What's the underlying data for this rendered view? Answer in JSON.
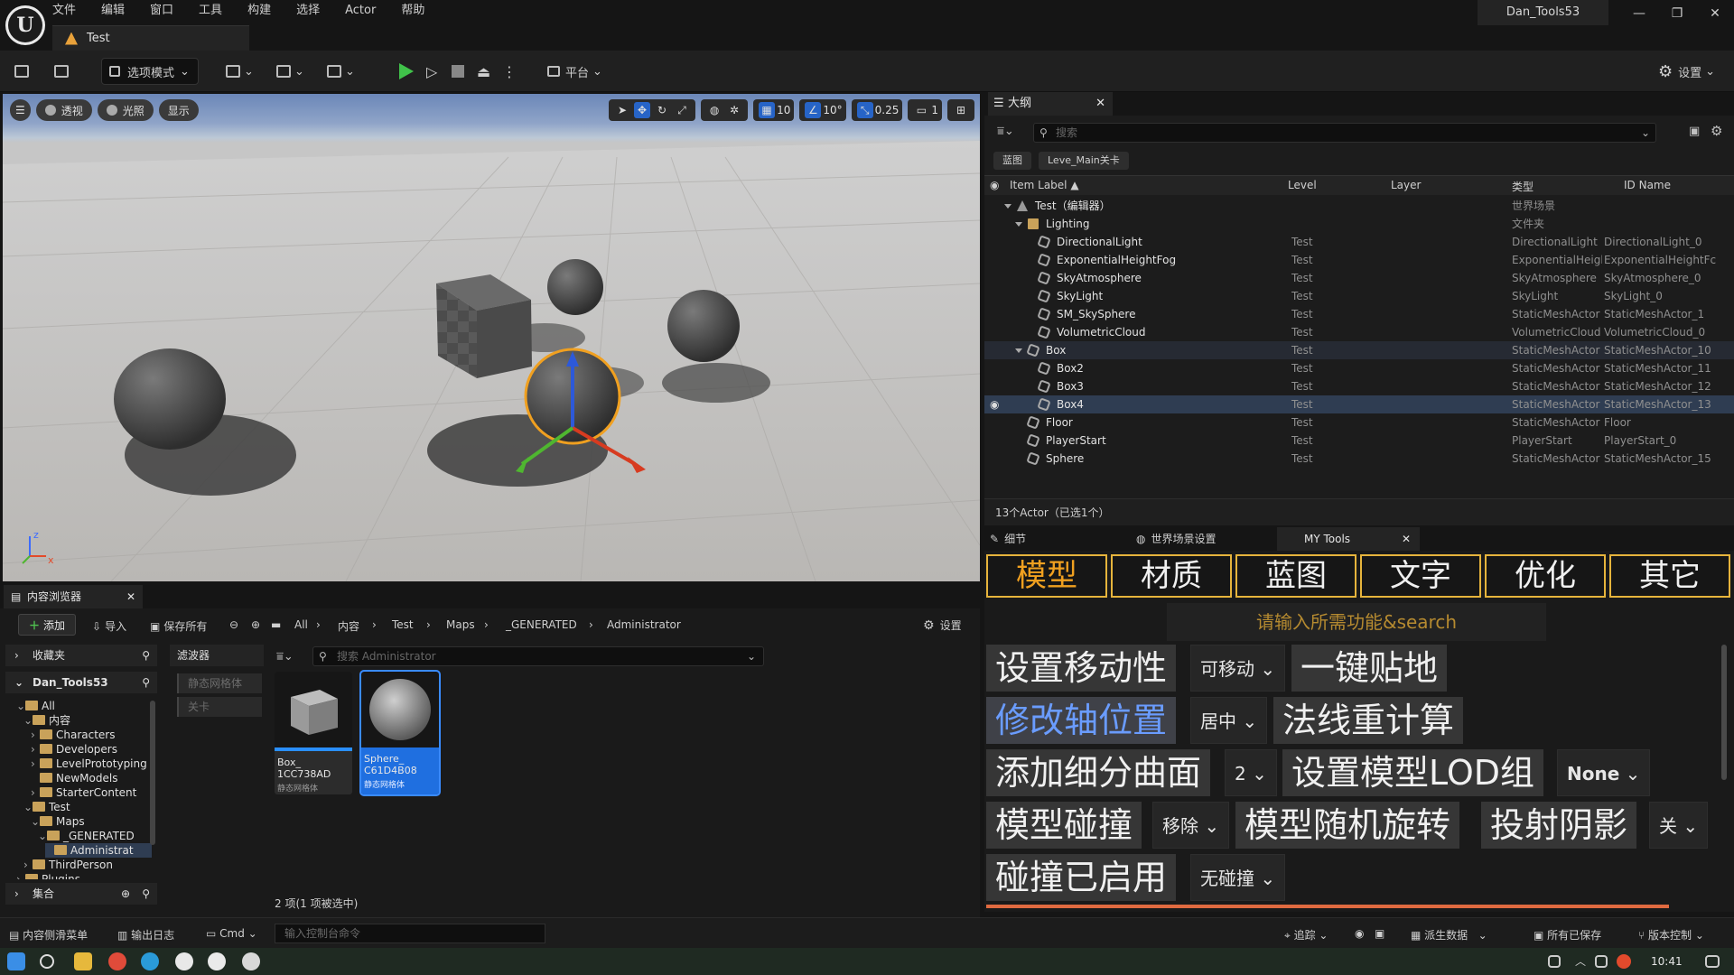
{
  "menu": [
    "文件",
    "编辑",
    "窗口",
    "工具",
    "构建",
    "选择",
    "Actor",
    "帮助"
  ],
  "level_tab": "Test",
  "project_name": "Dan_Tools53",
  "window_controls": {
    "minimize": "—",
    "restore": "❐",
    "close": "✕"
  },
  "toolbar": {
    "mode_label": "选项模式",
    "platform_label": "平台",
    "settings_label": "设置"
  },
  "viewport": {
    "perspective_label": "透视",
    "lighting_label": "光照",
    "show_label": "显示",
    "grid_snap": "10",
    "rotation_snap": "10°",
    "scale_snap": "0.25",
    "camera_speed": "1"
  },
  "outliner": {
    "tab_label": "大纲",
    "search_placeholder": "搜索",
    "chips": [
      "蓝图",
      "Leve_Main关卡"
    ],
    "headers": {
      "item_label": "Item Label ▲",
      "level": "Level",
      "layer": "Layer",
      "type": "类型",
      "id_name": "ID Name"
    },
    "rows": [
      {
        "label": "Test（编辑器）",
        "level": "",
        "type": "世界场景",
        "id": ""
      },
      {
        "label": "Lighting",
        "level": "",
        "type": "文件夹",
        "id": ""
      },
      {
        "label": "DirectionalLight",
        "level": "Test",
        "type": "DirectionalLight",
        "id": "DirectionalLight_0"
      },
      {
        "label": "ExponentialHeightFog",
        "level": "Test",
        "type": "ExponentialHeightFc",
        "id": "ExponentialHeightFc"
      },
      {
        "label": "SkyAtmosphere",
        "level": "Test",
        "type": "SkyAtmosphere",
        "id": "SkyAtmosphere_0"
      },
      {
        "label": "SkyLight",
        "level": "Test",
        "type": "SkyLight",
        "id": "SkyLight_0"
      },
      {
        "label": "SM_SkySphere",
        "level": "Test",
        "type": "StaticMeshActor",
        "id": "StaticMeshActor_1"
      },
      {
        "label": "VolumetricCloud",
        "level": "Test",
        "type": "VolumetricCloud",
        "id": "VolumetricCloud_0"
      },
      {
        "label": "Box",
        "level": "Test",
        "type": "StaticMeshActor",
        "id": "StaticMeshActor_10"
      },
      {
        "label": "Box2",
        "level": "Test",
        "type": "StaticMeshActor",
        "id": "StaticMeshActor_11"
      },
      {
        "label": "Box3",
        "level": "Test",
        "type": "StaticMeshActor",
        "id": "StaticMeshActor_12"
      },
      {
        "label": "Box4",
        "level": "Test",
        "type": "StaticMeshActor",
        "id": "StaticMeshActor_13"
      },
      {
        "label": "Floor",
        "level": "Test",
        "type": "StaticMeshActor",
        "id": "Floor"
      },
      {
        "label": "PlayerStart",
        "level": "Test",
        "type": "PlayerStart",
        "id": "PlayerStart_0"
      },
      {
        "label": "Sphere",
        "level": "Test",
        "type": "StaticMeshActor",
        "id": "StaticMeshActor_15"
      }
    ],
    "status": "13个Actor（已选1个）"
  },
  "details_tabs": {
    "details": "细节",
    "world_settings": "世界场景设置",
    "my_tools": "MY Tools"
  },
  "my_tools": {
    "categories": [
      "模型",
      "材质",
      "蓝图",
      "文字",
      "优化",
      "其它"
    ],
    "search_placeholder": "请输入所需功能&search",
    "buttons": {
      "set_mobility": "设置移动性",
      "mobility_value": "可移动",
      "snap_ground": "一键贴地",
      "pivot": "修改轴位置",
      "pivot_value": "居中",
      "recompute_normals": "法线重计算",
      "subdivide": "添加细分曲面",
      "subdivide_value": "2",
      "lod_group": "设置模型LOD组",
      "lod_value": "None",
      "collision": "模型碰撞",
      "collision_value": "移除",
      "random_rotate": "模型随机旋转",
      "cast_shadow": "投射阴影",
      "cast_shadow_value": "关",
      "collision_enabled": "碰撞已启用",
      "collision_enabled_value": "无碰撞"
    }
  },
  "content_browser": {
    "tab_label": "内容浏览器",
    "add_label": "添加",
    "import_label": "导入",
    "save_all_label": "保存所有",
    "settings_label": "设置",
    "breadcrumb": [
      "All",
      "内容",
      "Test",
      "Maps",
      "_GENERATED",
      "Administrator"
    ],
    "favorites": "收藏夹",
    "project": "Dan_Tools53",
    "filters_label": "滤波器",
    "filters": [
      "静态网格体",
      "关卡"
    ],
    "search_placeholder": "搜索 Administrator",
    "tree": [
      "All",
      "内容",
      "Characters",
      "Developers",
      "LevelPrototyping",
      "NewModels",
      "StarterContent",
      "Test",
      "Maps",
      "_GENERATED",
      "Administrat",
      "ThirdPerson",
      "Plugins"
    ],
    "collections": "集合",
    "assets": [
      {
        "name": "Box_\n1CC738AD",
        "type": "静态网格体"
      },
      {
        "name": "Sphere_\nC61D4B08",
        "type": "静态网格体"
      }
    ],
    "count": "2 项(1 项被选中)"
  },
  "statusbar": {
    "content_drawer": "内容侧滑菜单",
    "output_log": "输出日志",
    "cmd": "Cmd",
    "cmd_placeholder": "输入控制台命令",
    "trace": "追踪",
    "derived_data": "派生数据",
    "all_saved": "所有已保存",
    "source_control": "版本控制"
  },
  "taskbar": {
    "time": "10:41"
  }
}
